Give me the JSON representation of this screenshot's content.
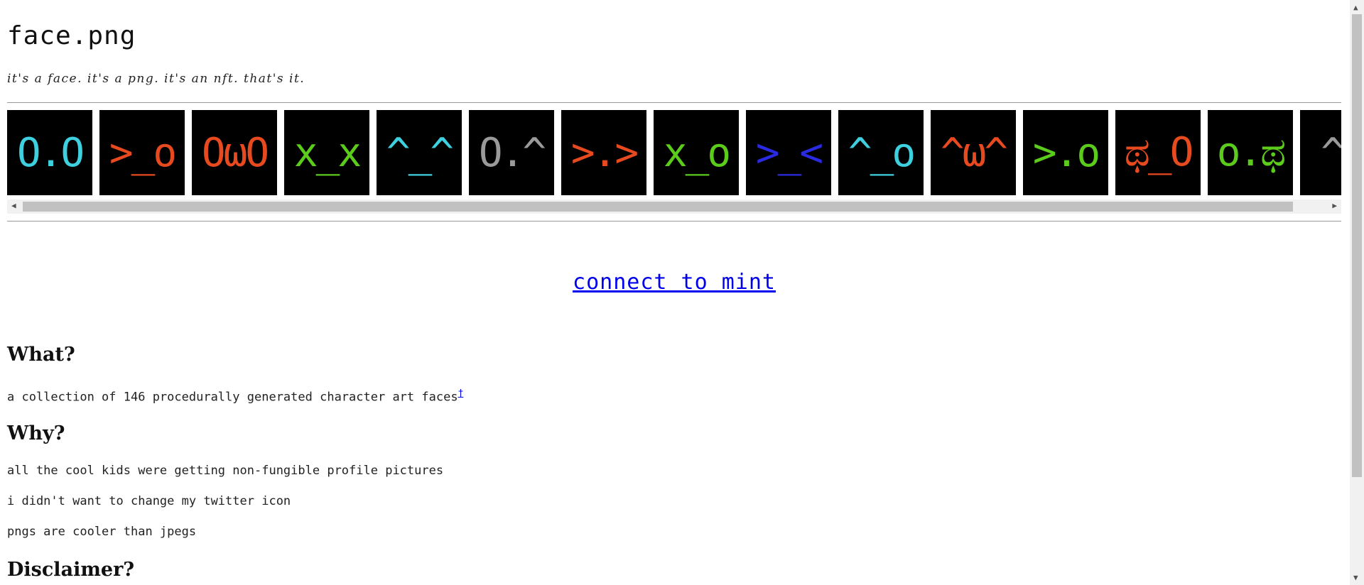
{
  "header": {
    "title": "face.png",
    "subtitle": "it's a face. it's a png. it's an nft. that's it."
  },
  "faces": [
    {
      "text": "O.O",
      "color": "#3fd0e0"
    },
    {
      "text": ">_o",
      "color": "#e84a20"
    },
    {
      "text": "OωO",
      "color": "#e84a20"
    },
    {
      "text": "x_x",
      "color": "#5ccc1c"
    },
    {
      "text": "^_^",
      "color": "#3fd0e0"
    },
    {
      "text": "O.^",
      "color": "#9a9a9a"
    },
    {
      "text": ">.>",
      "color": "#e84a20"
    },
    {
      "text": "x_o",
      "color": "#5ccc1c"
    },
    {
      "text": ">_<",
      "color": "#2a2ae0"
    },
    {
      "text": "^_o",
      "color": "#3fd0e0"
    },
    {
      "text": "^ω^",
      "color": "#e84a20"
    },
    {
      "text": ">.o",
      "color": "#5ccc1c"
    },
    {
      "text": "ಥ_O",
      "color": "#e84a20"
    },
    {
      "text": "o.ಥ",
      "color": "#5ccc1c"
    },
    {
      "text": "^.",
      "color": "#9a9a9a"
    }
  ],
  "connect_link": "connect to mint",
  "sections": {
    "what": {
      "heading": "What?",
      "text": "a collection of 146 procedurally generated character art faces",
      "footnote": "†"
    },
    "why": {
      "heading": "Why?",
      "lines": [
        "all the cool kids were getting non-fungible profile pictures",
        "i didn't want to change my twitter icon",
        "pngs are cooler than jpegs"
      ]
    },
    "disclaimer": {
      "heading": "Disclaimer?"
    }
  }
}
